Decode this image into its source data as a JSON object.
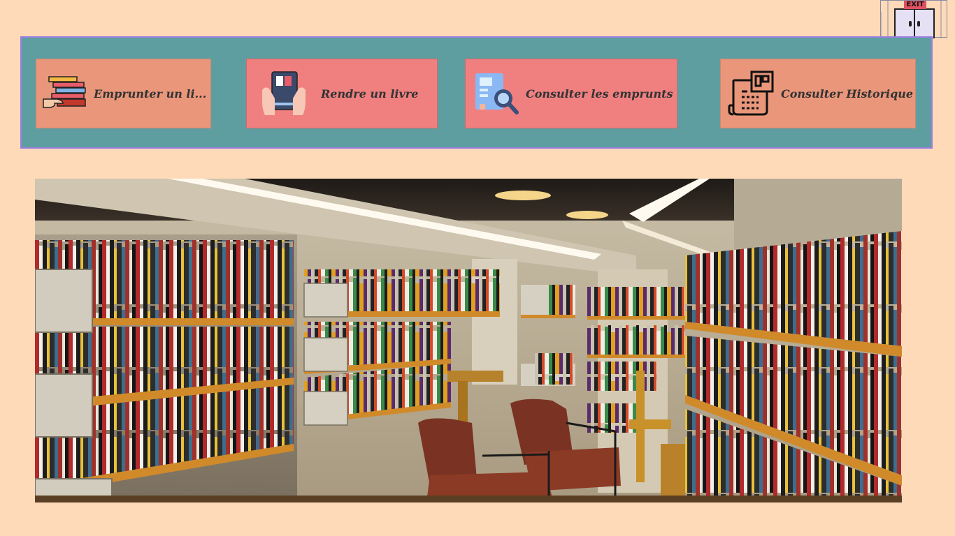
{
  "exit": {
    "label": "EXIT",
    "icon": "exit-door-icon"
  },
  "toolbar": {
    "buttons": [
      {
        "label": "Emprunter un li...",
        "icon": "borrow-books-icon"
      },
      {
        "label": "Rendre un livre",
        "icon": "return-book-icon"
      },
      {
        "label": "Consulter les emprunts",
        "icon": "search-document-icon"
      },
      {
        "label": "Consulter Historique",
        "icon": "history-ledger-icon"
      }
    ]
  },
  "hero": {
    "subject": "library-bookshelves-photo"
  },
  "colors": {
    "page_background": "#ffdab9",
    "toolbar_background": "#5f9ea0",
    "toolbar_border": "#9b7fe0",
    "button_salmon": "#e9967a",
    "button_coral": "#f08080"
  }
}
